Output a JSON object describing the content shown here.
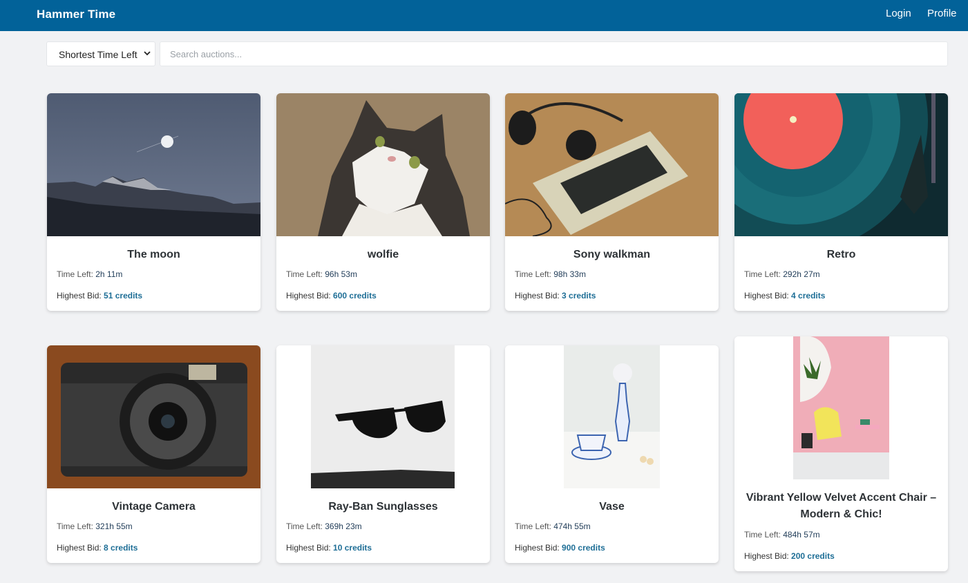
{
  "header": {
    "brand": "Hammer Time",
    "login": "Login",
    "profile": "Profile"
  },
  "controls": {
    "sort_selected": "Shortest Time Left",
    "search_placeholder": "Search auctions..."
  },
  "labels": {
    "time_left": "Time Left:",
    "highest_bid": "Highest Bid:"
  },
  "auctions": [
    {
      "title": "The moon",
      "time_left": "2h 11m",
      "bid": "51 credits",
      "image": "moon-over-mountains"
    },
    {
      "title": "wolfie",
      "time_left": "96h 53m",
      "bid": "600 credits",
      "image": "cat-looking-up"
    },
    {
      "title": "Sony walkman",
      "time_left": "98h 33m",
      "bid": "3 credits",
      "image": "walkman-with-headphones"
    },
    {
      "title": "Retro",
      "time_left": "292h 27m",
      "bid": "4 credits",
      "image": "vinyl-record-player"
    },
    {
      "title": "Vintage Camera",
      "time_left": "321h 55m",
      "bid": "8 credits",
      "image": "vintage-camera"
    },
    {
      "title": "Ray-Ban Sunglasses",
      "time_left": "369h 23m",
      "bid": "10 credits",
      "image": "sunglasses"
    },
    {
      "title": "Vase",
      "time_left": "474h 55m",
      "bid": "900 credits",
      "image": "vase-and-teacup"
    },
    {
      "title": "Vibrant Yellow Velvet Accent Chair – Modern & Chic!",
      "time_left": "484h 57m",
      "bid": "200 credits",
      "image": "yellow-chair-pink-wall"
    }
  ]
}
